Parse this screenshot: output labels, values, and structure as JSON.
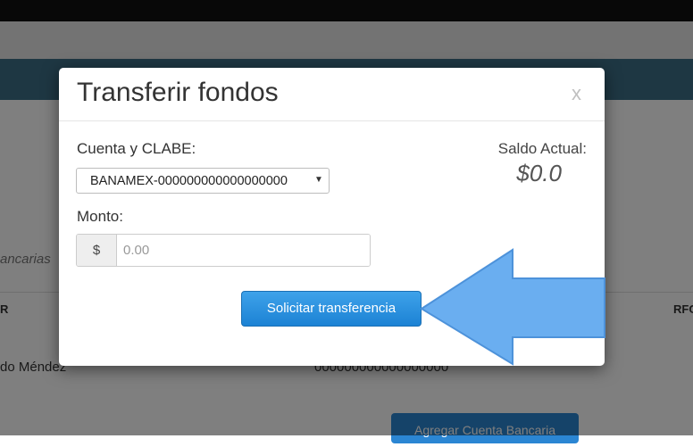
{
  "background": {
    "table_caption": "ancarias",
    "col_header_left": "R",
    "col_header_right": "RFC",
    "row_name": "do Méndez",
    "row_account": "000000000000000000",
    "add_account_button": "Agregar Cuenta Bancaria"
  },
  "modal": {
    "title": "Transferir fondos",
    "close_label": "x",
    "account_label": "Cuenta y CLABE:",
    "account_selected": "BANAMEX-000000000000000000",
    "amount_label": "Monto:",
    "currency_addon": "$",
    "amount_placeholder": "0.00",
    "balance_label": "Saldo Actual:",
    "balance_value": "$0.0",
    "submit_label": "Solicitar transferencia"
  },
  "colors": {
    "primary_button": "#2a90df",
    "arrow_fill": "#6aaef0",
    "arrow_stroke": "#4d92da"
  },
  "icons": {
    "close": "close-icon",
    "select_caret": "caret-down-icon",
    "pointer_arrow": "arrow-left-icon"
  }
}
